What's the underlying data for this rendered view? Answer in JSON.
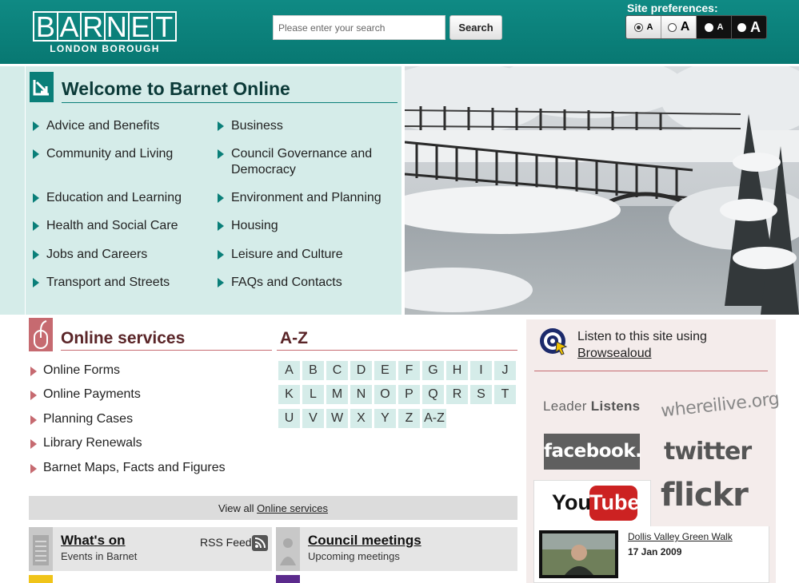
{
  "header": {
    "logo_word": "BARNET",
    "logo_subtitle": "LONDON BOROUGH",
    "search_placeholder": "Please enter your search",
    "search_button": "Search",
    "prefs_label": "Site preferences:",
    "prefs": [
      {
        "label": "A",
        "style": "normal-light",
        "selected": true
      },
      {
        "label": "A",
        "style": "large-light",
        "selected": false
      },
      {
        "label": "A",
        "style": "normal-dark",
        "selected": false
      },
      {
        "label": "A",
        "style": "large-dark",
        "selected": false
      }
    ]
  },
  "welcome": {
    "title": "Welcome to Barnet Online",
    "links_left": [
      "Advice and Benefits",
      "Community and Living",
      "Education and Learning",
      "Health and Social Care",
      "Jobs and Careers",
      "Transport and Streets"
    ],
    "links_right": [
      "Business",
      "Council Governance and Democracy",
      "Environment and Planning",
      "Housing",
      "Leisure and Culture",
      "FAQs and Contacts"
    ]
  },
  "online_services": {
    "title": "Online services",
    "links": [
      "Online Forms",
      "Online Payments",
      "Planning Cases",
      "Library Renewals",
      "Barnet Maps, Facts and Figures"
    ],
    "view_all_prefix": "View all",
    "view_all_link": "Online services"
  },
  "az": {
    "title": "A-Z",
    "letters": [
      "A",
      "B",
      "C",
      "D",
      "E",
      "F",
      "G",
      "H",
      "I",
      "J",
      "K",
      "L",
      "M",
      "N",
      "O",
      "P",
      "Q",
      "R",
      "S",
      "T",
      "U",
      "V",
      "W",
      "X",
      "Y",
      "Z",
      "A-Z"
    ]
  },
  "whats_on": {
    "title": "What's on",
    "subtitle": "Events in Barnet",
    "rss_label": "RSS Feed"
  },
  "council_meetings": {
    "title": "Council meetings",
    "subtitle": "Upcoming meetings"
  },
  "sidebar": {
    "browsealoud_text": "Listen to this site using",
    "browsealoud_link": "Browsealoud",
    "leader_listens_a": "Leader ",
    "leader_listens_b": "Listens",
    "whereilive": "whereilive.org",
    "facebook": "facebook.",
    "twitter": "twitter",
    "youtube_you": "You",
    "youtube_tube": "Tube",
    "flickr": "flickr",
    "video_title": "Dollis Valley Green Walk",
    "video_date": "17 Jan 2009"
  },
  "colors": {
    "teal": "#0a7f79",
    "light_teal": "#d5ece9",
    "rose": "#c66a70",
    "yellow": "#f0c419",
    "purple": "#5b2a8c"
  }
}
